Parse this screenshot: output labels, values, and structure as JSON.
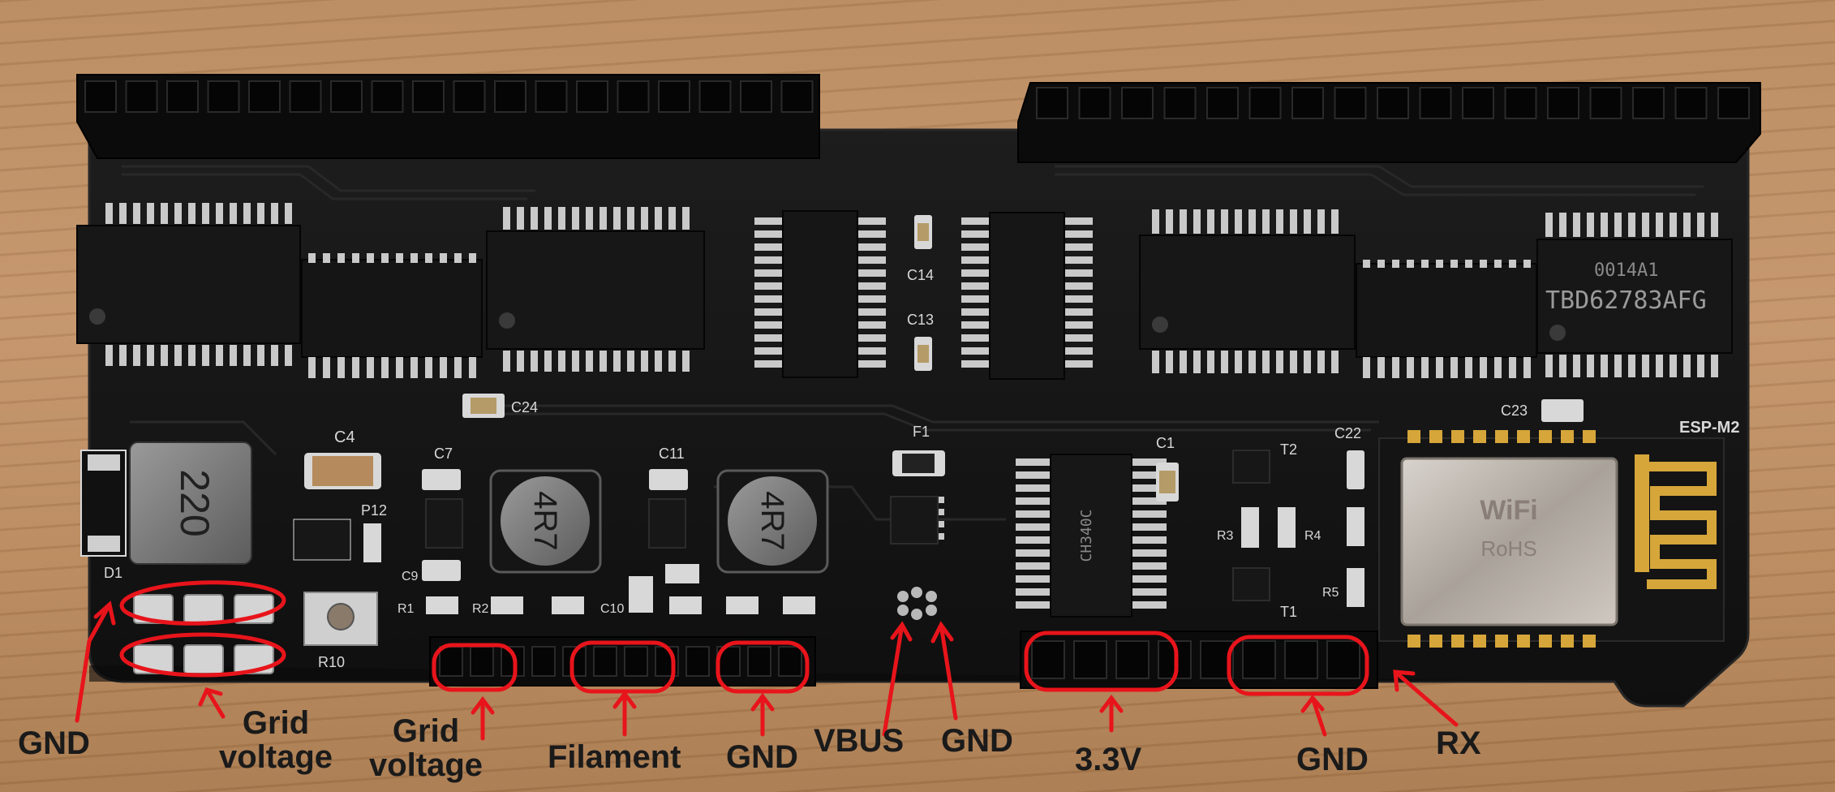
{
  "board": {
    "module_name": "ESP-M2",
    "module_marking": "WiFi",
    "module_marking_2": "RoHS",
    "driver_chip_marking": "TBD62783AFG",
    "driver_chip_marking_2": "0014A1",
    "inductor_large": "220",
    "inductor_small_1": "4R7",
    "inductor_small_2": "4R7",
    "usb_chip_marking": "CH340C",
    "silkscreen": {
      "d1": "D1",
      "r10": "R10",
      "p12": "P12",
      "c4": "C4",
      "c7": "C7",
      "c11": "C11",
      "c9": "C9",
      "r1": "R1",
      "r2": "R2",
      "c10": "C10",
      "c14": "C14",
      "c13": "C13",
      "c24": "C24",
      "f1": "F1",
      "c1": "C1",
      "t2": "T2",
      "r3": "R3",
      "r4": "R4",
      "r5": "R5",
      "t1": "T1",
      "c22": "C22",
      "c23": "C23"
    }
  },
  "annotations": [
    {
      "id": "gnd-left",
      "text": "GND"
    },
    {
      "id": "grid-voltage-1",
      "text": "Grid\nvoltage"
    },
    {
      "id": "grid-voltage-2",
      "text": "Grid\nvoltage"
    },
    {
      "id": "filament",
      "text": "Filament"
    },
    {
      "id": "gnd-2",
      "text": "GND"
    },
    {
      "id": "vbus",
      "text": "VBUS"
    },
    {
      "id": "gnd-3",
      "text": "GND"
    },
    {
      "id": "v33",
      "text": "3.3V"
    },
    {
      "id": "gnd-4",
      "text": "GND"
    },
    {
      "id": "rx",
      "text": "RX"
    }
  ],
  "colors": {
    "annotation": "#e8141b",
    "pcb": "#141414",
    "header": "#0b0b0b",
    "silk": "#d8d8d8",
    "gold": "#d6a63a",
    "wood": "#c4946a"
  }
}
